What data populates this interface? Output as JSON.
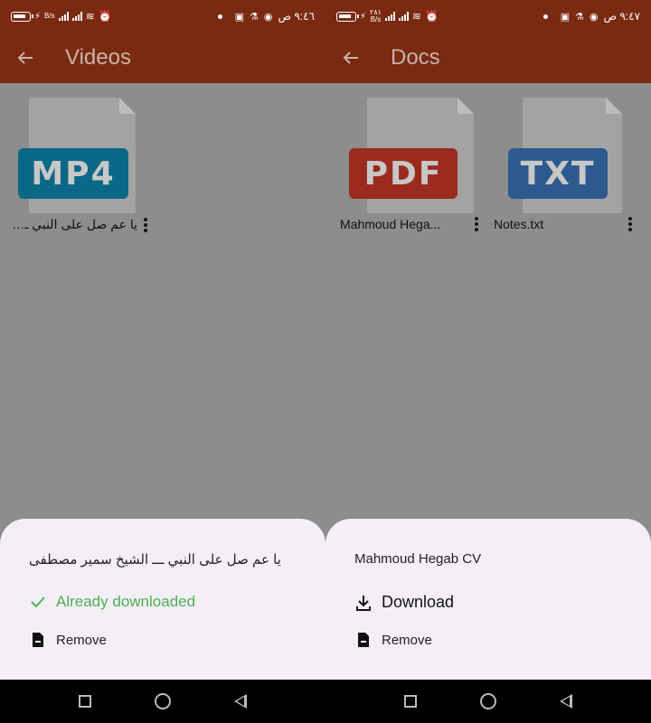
{
  "left": {
    "status": {
      "time": "٩:٤٦ ص",
      "net_speed": "B/s"
    },
    "title": "Videos",
    "files": [
      {
        "name": "يا عم صل على النبي ـــ ...",
        "type": "MP4"
      }
    ],
    "sheet": {
      "title": "يا عم صل على النبي ـــ الشيخ سمير مصطفى",
      "primary_label": "Already downloaded",
      "remove_label": "Remove"
    }
  },
  "right": {
    "status": {
      "time": "٩:٤٧ ص",
      "net_speed": "B/s",
      "net_value": "٢٨١"
    },
    "title": "Docs",
    "files": [
      {
        "name": "Mahmoud Hega...",
        "type": "PDF"
      },
      {
        "name": "Notes.txt",
        "type": "TXT"
      }
    ],
    "sheet": {
      "title": "Mahmoud Hegab CV",
      "primary_label": "Download",
      "remove_label": "Remove"
    }
  },
  "colors": {
    "appbar": "#7a2a10",
    "sheet": "#f4eff7",
    "success": "#4caf50"
  }
}
